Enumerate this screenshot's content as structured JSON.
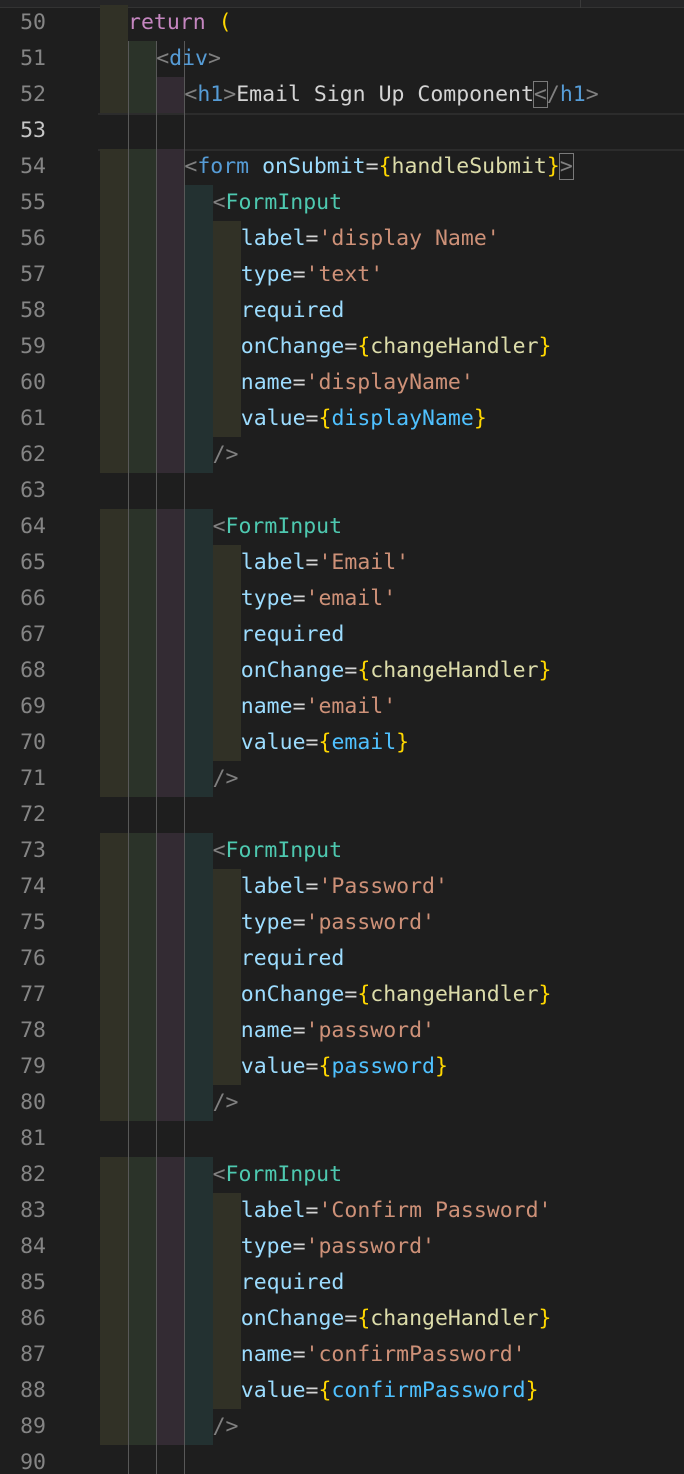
{
  "editor": {
    "language": "javascript-react",
    "current_line": 53,
    "theme_colors": {
      "background": "#1e1e1e",
      "keyword": "#c586c0",
      "html_tag": "#569cd6",
      "component": "#4ec9b0",
      "attribute": "#9cdcfe",
      "string": "#ce9178",
      "function": "#dcdcaa",
      "variable": "#4fc1ff",
      "bracket": "#ffd700",
      "punctuation": "#808080",
      "line_number": "#858585"
    },
    "lines": [
      {
        "n": "50",
        "indent": "    ",
        "tokens": [
          {
            "t": "return",
            "c": "kw"
          },
          {
            "t": " ",
            "c": "txt"
          },
          {
            "t": "(",
            "c": "br"
          }
        ]
      },
      {
        "n": "51",
        "indent": "      ",
        "tokens": [
          {
            "t": "<",
            "c": "pun"
          },
          {
            "t": "div",
            "c": "tag"
          },
          {
            "t": ">",
            "c": "pun"
          }
        ]
      },
      {
        "n": "52",
        "indent": "        ",
        "tokens": [
          {
            "t": "<",
            "c": "pun"
          },
          {
            "t": "h1",
            "c": "tag"
          },
          {
            "t": ">",
            "c": "pun"
          },
          {
            "t": "Email Sign Up Component",
            "c": "txt"
          },
          {
            "t": "<",
            "c": "pun bmatch"
          },
          {
            "t": "/",
            "c": "pun"
          },
          {
            "t": "h1",
            "c": "tag"
          },
          {
            "t": ">",
            "c": "pun"
          }
        ]
      },
      {
        "n": "53",
        "indent": "",
        "tokens": []
      },
      {
        "n": "54",
        "indent": "        ",
        "tokens": [
          {
            "t": "<",
            "c": "pun"
          },
          {
            "t": "form",
            "c": "tag"
          },
          {
            "t": " ",
            "c": "txt"
          },
          {
            "t": "onSubmit",
            "c": "attr"
          },
          {
            "t": "=",
            "c": "op"
          },
          {
            "t": "{",
            "c": "br"
          },
          {
            "t": "handleSubmit",
            "c": "fn"
          },
          {
            "t": "}",
            "c": "br"
          },
          {
            "t": ">",
            "c": "pun bmatch"
          }
        ]
      },
      {
        "n": "55",
        "indent": "          ",
        "tokens": [
          {
            "t": "<",
            "c": "pun"
          },
          {
            "t": "FormInput",
            "c": "comp"
          }
        ]
      },
      {
        "n": "56",
        "indent": "            ",
        "tokens": [
          {
            "t": "label",
            "c": "attr"
          },
          {
            "t": "=",
            "c": "op"
          },
          {
            "t": "'display Name'",
            "c": "str"
          }
        ]
      },
      {
        "n": "57",
        "indent": "            ",
        "tokens": [
          {
            "t": "type",
            "c": "attr"
          },
          {
            "t": "=",
            "c": "op"
          },
          {
            "t": "'text'",
            "c": "str"
          }
        ]
      },
      {
        "n": "58",
        "indent": "            ",
        "tokens": [
          {
            "t": "required",
            "c": "attr"
          }
        ]
      },
      {
        "n": "59",
        "indent": "            ",
        "tokens": [
          {
            "t": "onChange",
            "c": "attr"
          },
          {
            "t": "=",
            "c": "op"
          },
          {
            "t": "{",
            "c": "br"
          },
          {
            "t": "changeHandler",
            "c": "fn"
          },
          {
            "t": "}",
            "c": "br"
          }
        ]
      },
      {
        "n": "60",
        "indent": "            ",
        "tokens": [
          {
            "t": "name",
            "c": "attr"
          },
          {
            "t": "=",
            "c": "op"
          },
          {
            "t": "'displayName'",
            "c": "str"
          }
        ]
      },
      {
        "n": "61",
        "indent": "            ",
        "tokens": [
          {
            "t": "value",
            "c": "attr"
          },
          {
            "t": "=",
            "c": "op"
          },
          {
            "t": "{",
            "c": "br"
          },
          {
            "t": "displayName",
            "c": "var"
          },
          {
            "t": "}",
            "c": "br"
          }
        ]
      },
      {
        "n": "62",
        "indent": "          ",
        "tokens": [
          {
            "t": "/>",
            "c": "pun"
          }
        ]
      },
      {
        "n": "63",
        "indent": "",
        "tokens": []
      },
      {
        "n": "64",
        "indent": "          ",
        "tokens": [
          {
            "t": "<",
            "c": "pun"
          },
          {
            "t": "FormInput",
            "c": "comp"
          }
        ]
      },
      {
        "n": "65",
        "indent": "            ",
        "tokens": [
          {
            "t": "label",
            "c": "attr"
          },
          {
            "t": "=",
            "c": "op"
          },
          {
            "t": "'Email'",
            "c": "str"
          }
        ]
      },
      {
        "n": "66",
        "indent": "            ",
        "tokens": [
          {
            "t": "type",
            "c": "attr"
          },
          {
            "t": "=",
            "c": "op"
          },
          {
            "t": "'email'",
            "c": "str"
          }
        ]
      },
      {
        "n": "67",
        "indent": "            ",
        "tokens": [
          {
            "t": "required",
            "c": "attr"
          }
        ]
      },
      {
        "n": "68",
        "indent": "            ",
        "tokens": [
          {
            "t": "onChange",
            "c": "attr"
          },
          {
            "t": "=",
            "c": "op"
          },
          {
            "t": "{",
            "c": "br"
          },
          {
            "t": "changeHandler",
            "c": "fn"
          },
          {
            "t": "}",
            "c": "br"
          }
        ]
      },
      {
        "n": "69",
        "indent": "            ",
        "tokens": [
          {
            "t": "name",
            "c": "attr"
          },
          {
            "t": "=",
            "c": "op"
          },
          {
            "t": "'email'",
            "c": "str"
          }
        ]
      },
      {
        "n": "70",
        "indent": "            ",
        "tokens": [
          {
            "t": "value",
            "c": "attr"
          },
          {
            "t": "=",
            "c": "op"
          },
          {
            "t": "{",
            "c": "br"
          },
          {
            "t": "email",
            "c": "var"
          },
          {
            "t": "}",
            "c": "br"
          }
        ]
      },
      {
        "n": "71",
        "indent": "          ",
        "tokens": [
          {
            "t": "/>",
            "c": "pun"
          }
        ]
      },
      {
        "n": "72",
        "indent": "",
        "tokens": []
      },
      {
        "n": "73",
        "indent": "          ",
        "tokens": [
          {
            "t": "<",
            "c": "pun"
          },
          {
            "t": "FormInput",
            "c": "comp"
          }
        ]
      },
      {
        "n": "74",
        "indent": "            ",
        "tokens": [
          {
            "t": "label",
            "c": "attr"
          },
          {
            "t": "=",
            "c": "op"
          },
          {
            "t": "'Password'",
            "c": "str"
          }
        ]
      },
      {
        "n": "75",
        "indent": "            ",
        "tokens": [
          {
            "t": "type",
            "c": "attr"
          },
          {
            "t": "=",
            "c": "op"
          },
          {
            "t": "'password'",
            "c": "str"
          }
        ]
      },
      {
        "n": "76",
        "indent": "            ",
        "tokens": [
          {
            "t": "required",
            "c": "attr"
          }
        ]
      },
      {
        "n": "77",
        "indent": "            ",
        "tokens": [
          {
            "t": "onChange",
            "c": "attr"
          },
          {
            "t": "=",
            "c": "op"
          },
          {
            "t": "{",
            "c": "br"
          },
          {
            "t": "changeHandler",
            "c": "fn"
          },
          {
            "t": "}",
            "c": "br"
          }
        ]
      },
      {
        "n": "78",
        "indent": "            ",
        "tokens": [
          {
            "t": "name",
            "c": "attr"
          },
          {
            "t": "=",
            "c": "op"
          },
          {
            "t": "'password'",
            "c": "str"
          }
        ]
      },
      {
        "n": "79",
        "indent": "            ",
        "tokens": [
          {
            "t": "value",
            "c": "attr"
          },
          {
            "t": "=",
            "c": "op"
          },
          {
            "t": "{",
            "c": "br"
          },
          {
            "t": "password",
            "c": "var"
          },
          {
            "t": "}",
            "c": "br"
          }
        ]
      },
      {
        "n": "80",
        "indent": "          ",
        "tokens": [
          {
            "t": "/>",
            "c": "pun"
          }
        ]
      },
      {
        "n": "81",
        "indent": "",
        "tokens": []
      },
      {
        "n": "82",
        "indent": "          ",
        "tokens": [
          {
            "t": "<",
            "c": "pun"
          },
          {
            "t": "FormInput",
            "c": "comp"
          }
        ]
      },
      {
        "n": "83",
        "indent": "            ",
        "tokens": [
          {
            "t": "label",
            "c": "attr"
          },
          {
            "t": "=",
            "c": "op"
          },
          {
            "t": "'Confirm Password'",
            "c": "str"
          }
        ]
      },
      {
        "n": "84",
        "indent": "            ",
        "tokens": [
          {
            "t": "type",
            "c": "attr"
          },
          {
            "t": "=",
            "c": "op"
          },
          {
            "t": "'password'",
            "c": "str"
          }
        ]
      },
      {
        "n": "85",
        "indent": "            ",
        "tokens": [
          {
            "t": "required",
            "c": "attr"
          }
        ]
      },
      {
        "n": "86",
        "indent": "            ",
        "tokens": [
          {
            "t": "onChange",
            "c": "attr"
          },
          {
            "t": "=",
            "c": "op"
          },
          {
            "t": "{",
            "c": "br"
          },
          {
            "t": "changeHandler",
            "c": "fn"
          },
          {
            "t": "}",
            "c": "br"
          }
        ]
      },
      {
        "n": "87",
        "indent": "            ",
        "tokens": [
          {
            "t": "name",
            "c": "attr"
          },
          {
            "t": "=",
            "c": "op"
          },
          {
            "t": "'confirmPassword'",
            "c": "str"
          }
        ]
      },
      {
        "n": "88",
        "indent": "            ",
        "tokens": [
          {
            "t": "value",
            "c": "attr"
          },
          {
            "t": "=",
            "c": "op"
          },
          {
            "t": "{",
            "c": "br"
          },
          {
            "t": "confirmPassword",
            "c": "var"
          },
          {
            "t": "}",
            "c": "br"
          }
        ]
      },
      {
        "n": "89",
        "indent": "          ",
        "tokens": [
          {
            "t": "/>",
            "c": "pun"
          }
        ]
      },
      {
        "n": "90",
        "indent": "",
        "tokens": []
      }
    ]
  }
}
